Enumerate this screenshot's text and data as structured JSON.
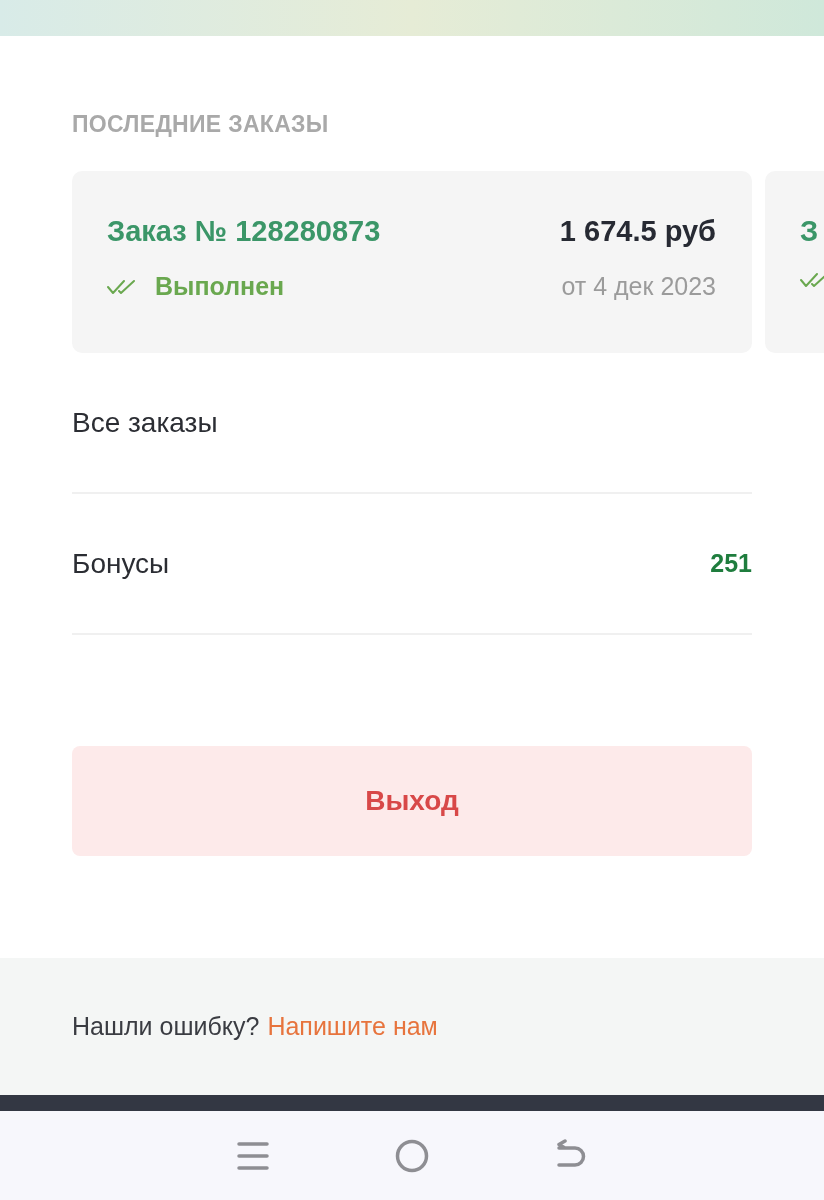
{
  "section_title": "ПОСЛЕДНИЕ ЗАКАЗЫ",
  "orders": [
    {
      "title": "Заказ № 128280873",
      "price": "1 674.5 руб",
      "status": "Выполнен",
      "date": "от 4 дек 2023",
      "done": true
    },
    {
      "title": "З",
      "done": true
    }
  ],
  "menu": [
    {
      "label": "Все заказы"
    },
    {
      "label": "Бонусы",
      "value": "251"
    }
  ],
  "logout_button": "Выход",
  "footer": {
    "text": "Нашли ошибку?",
    "link": "Напишите нам"
  }
}
